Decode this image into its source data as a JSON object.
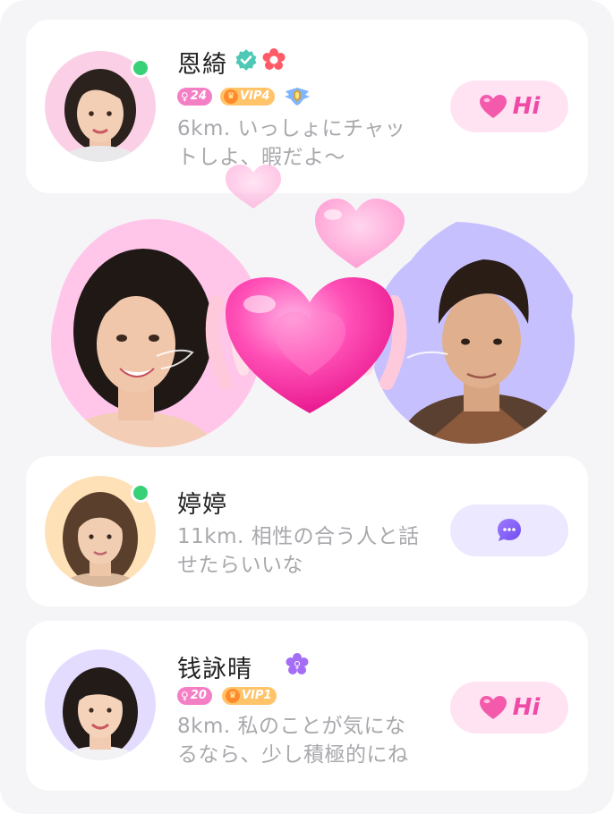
{
  "users": [
    {
      "name": "恩綺",
      "age_tag": "24",
      "vip_tag": "VIP4",
      "desc_line1": "6km. いっしょにチャッ",
      "desc_line2": "トしよ、暇だよ〜",
      "action": "Hi"
    },
    {
      "name": "婷婷",
      "desc_line1": "11km. 相性の合う人と話",
      "desc_line2": "せたらいいな",
      "action": "chat"
    },
    {
      "name": "钱詠晴",
      "age_tag": "20",
      "vip_tag": "VIP1",
      "desc_line1": "8km. 私のことが気にな",
      "desc_line2": "るなら、少し積極的にね",
      "action": "Hi"
    }
  ],
  "icons": {
    "verified": "verified-check-icon",
    "flower": "red-flower-badge-icon",
    "wings": "winged-emblem-icon",
    "female": "female-symbol-icon",
    "crown": "crown-icon",
    "heart": "heart-icon",
    "chat": "chat-bubble-icon"
  },
  "colors": {
    "accent_pink": "#f04aa6",
    "hi_button_bg": "#ffe3f3",
    "chat_button_bg": "#ebe8ff",
    "online": "#37d178",
    "match_left_bg": "#ffc6ea",
    "match_right_bg": "#c7c0ff"
  }
}
